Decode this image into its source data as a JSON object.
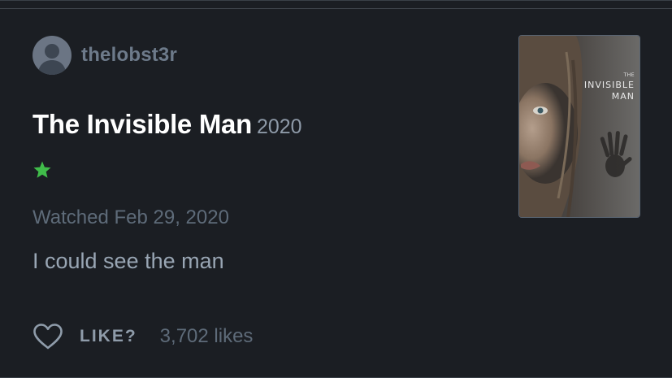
{
  "review_card": {
    "username": "thelobst3r",
    "film": {
      "title": "The Invisible Man",
      "year": "2020",
      "rating_stars": 0.5,
      "rating_color": "#40bc4a"
    },
    "watched_text": "Watched Feb 29, 2020",
    "review_text": "I could see the man",
    "like": {
      "label": "LIKE?",
      "count_text": "3,702 likes",
      "icon": "heart-outline-icon"
    },
    "poster": {
      "the": "THE",
      "invisible": "INVISIBLE",
      "man": "MAN"
    },
    "avatar_icon": "default-user-avatar-icon"
  },
  "colors": {
    "background": "#1b1e23",
    "username": "#6d7a8a",
    "title": "#ffffff",
    "muted": "#5e6b79",
    "body_text": "#99a6b4",
    "star": "#40bc4a"
  }
}
